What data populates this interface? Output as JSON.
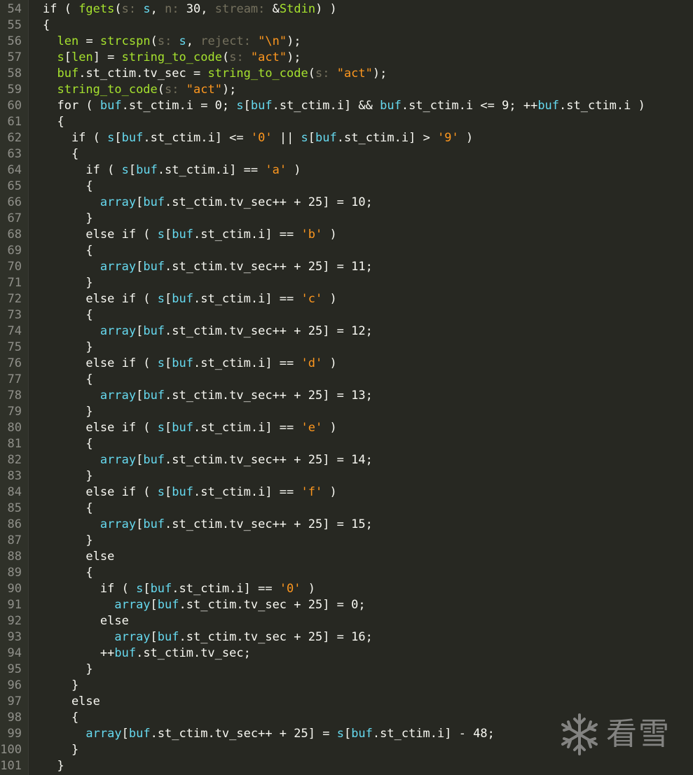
{
  "editor": {
    "first_line_number": 54,
    "lines": [
      [
        [
          "kw",
          "if ( "
        ],
        [
          "fn",
          "fgets"
        ],
        [
          "kw",
          "("
        ],
        [
          "hint",
          "s: "
        ],
        [
          "id",
          "s"
        ],
        [
          "kw",
          ", "
        ],
        [
          "hint",
          "n: "
        ],
        [
          "kw",
          "30, "
        ],
        [
          "hint",
          "stream: "
        ],
        [
          "kw",
          "&"
        ],
        [
          "fn",
          "Stdin"
        ],
        [
          "kw",
          ") )"
        ]
      ],
      [
        [
          "kw",
          "{"
        ]
      ],
      [
        [
          "kw",
          "  "
        ],
        [
          "fn",
          "len"
        ],
        [
          "kw",
          " = "
        ],
        [
          "fn",
          "strcspn"
        ],
        [
          "kw",
          "("
        ],
        [
          "hint",
          "s: "
        ],
        [
          "id",
          "s"
        ],
        [
          "kw",
          ", "
        ],
        [
          "hint",
          "reject: "
        ],
        [
          "str",
          "\"\\n\""
        ],
        [
          "kw",
          ");"
        ]
      ],
      [
        [
          "kw",
          "  "
        ],
        [
          "fn",
          "s"
        ],
        [
          "kw",
          "["
        ],
        [
          "fn",
          "len"
        ],
        [
          "kw",
          "] = "
        ],
        [
          "fn",
          "string_to_code"
        ],
        [
          "kw",
          "("
        ],
        [
          "hint",
          "s: "
        ],
        [
          "str",
          "\"act\""
        ],
        [
          "kw",
          ");"
        ]
      ],
      [
        [
          "kw",
          "  "
        ],
        [
          "fn",
          "buf"
        ],
        [
          "kw",
          ".st_ctim.tv_sec = "
        ],
        [
          "fn",
          "string_to_code"
        ],
        [
          "kw",
          "("
        ],
        [
          "hint",
          "s: "
        ],
        [
          "str",
          "\"act\""
        ],
        [
          "kw",
          ");"
        ]
      ],
      [
        [
          "kw",
          "  "
        ],
        [
          "fn",
          "string_to_code"
        ],
        [
          "kw",
          "("
        ],
        [
          "hint",
          "s: "
        ],
        [
          "str",
          "\"act\""
        ],
        [
          "kw",
          ");"
        ]
      ],
      [
        [
          "kw",
          "  for ( "
        ],
        [
          "id",
          "buf"
        ],
        [
          "kw",
          ".st_ctim.i = 0; "
        ],
        [
          "id",
          "s"
        ],
        [
          "kw",
          "["
        ],
        [
          "id",
          "buf"
        ],
        [
          "kw",
          ".st_ctim.i] && "
        ],
        [
          "id",
          "buf"
        ],
        [
          "kw",
          ".st_ctim.i <= 9; ++"
        ],
        [
          "id",
          "buf"
        ],
        [
          "kw",
          ".st_ctim.i )"
        ]
      ],
      [
        [
          "kw",
          "  {"
        ]
      ],
      [
        [
          "kw",
          "    if ( "
        ],
        [
          "id",
          "s"
        ],
        [
          "kw",
          "["
        ],
        [
          "id",
          "buf"
        ],
        [
          "kw",
          ".st_ctim.i] <= "
        ],
        [
          "str",
          "'0'"
        ],
        [
          "kw",
          " || "
        ],
        [
          "id",
          "s"
        ],
        [
          "kw",
          "["
        ],
        [
          "id",
          "buf"
        ],
        [
          "kw",
          ".st_ctim.i] > "
        ],
        [
          "str",
          "'9'"
        ],
        [
          "kw",
          " )"
        ]
      ],
      [
        [
          "kw",
          "    {"
        ]
      ],
      [
        [
          "kw",
          "      if ( "
        ],
        [
          "id",
          "s"
        ],
        [
          "kw",
          "["
        ],
        [
          "id",
          "buf"
        ],
        [
          "kw",
          ".st_ctim.i] == "
        ],
        [
          "str",
          "'a'"
        ],
        [
          "kw",
          " )"
        ]
      ],
      [
        [
          "kw",
          "      {"
        ]
      ],
      [
        [
          "kw",
          "        "
        ],
        [
          "id",
          "array"
        ],
        [
          "kw",
          "["
        ],
        [
          "id",
          "buf"
        ],
        [
          "kw",
          ".st_ctim.tv_sec++ + 25] = 10;"
        ]
      ],
      [
        [
          "kw",
          "      }"
        ]
      ],
      [
        [
          "kw",
          "      else if ( "
        ],
        [
          "id",
          "s"
        ],
        [
          "kw",
          "["
        ],
        [
          "id",
          "buf"
        ],
        [
          "kw",
          ".st_ctim.i] == "
        ],
        [
          "str",
          "'b'"
        ],
        [
          "kw",
          " )"
        ]
      ],
      [
        [
          "kw",
          "      {"
        ]
      ],
      [
        [
          "kw",
          "        "
        ],
        [
          "id",
          "array"
        ],
        [
          "kw",
          "["
        ],
        [
          "id",
          "buf"
        ],
        [
          "kw",
          ".st_ctim.tv_sec++ + 25] = 11;"
        ]
      ],
      [
        [
          "kw",
          "      }"
        ]
      ],
      [
        [
          "kw",
          "      else if ( "
        ],
        [
          "id",
          "s"
        ],
        [
          "kw",
          "["
        ],
        [
          "id",
          "buf"
        ],
        [
          "kw",
          ".st_ctim.i] == "
        ],
        [
          "str",
          "'c'"
        ],
        [
          "kw",
          " )"
        ]
      ],
      [
        [
          "kw",
          "      {"
        ]
      ],
      [
        [
          "kw",
          "        "
        ],
        [
          "id",
          "array"
        ],
        [
          "kw",
          "["
        ],
        [
          "id",
          "buf"
        ],
        [
          "kw",
          ".st_ctim.tv_sec++ + 25] = 12;"
        ]
      ],
      [
        [
          "kw",
          "      }"
        ]
      ],
      [
        [
          "kw",
          "      else if ( "
        ],
        [
          "id",
          "s"
        ],
        [
          "kw",
          "["
        ],
        [
          "id",
          "buf"
        ],
        [
          "kw",
          ".st_ctim.i] == "
        ],
        [
          "str",
          "'d'"
        ],
        [
          "kw",
          " )"
        ]
      ],
      [
        [
          "kw",
          "      {"
        ]
      ],
      [
        [
          "kw",
          "        "
        ],
        [
          "id",
          "array"
        ],
        [
          "kw",
          "["
        ],
        [
          "id",
          "buf"
        ],
        [
          "kw",
          ".st_ctim.tv_sec++ + 25] = 13;"
        ]
      ],
      [
        [
          "kw",
          "      }"
        ]
      ],
      [
        [
          "kw",
          "      else if ( "
        ],
        [
          "id",
          "s"
        ],
        [
          "kw",
          "["
        ],
        [
          "id",
          "buf"
        ],
        [
          "kw",
          ".st_ctim.i] == "
        ],
        [
          "str",
          "'e'"
        ],
        [
          "kw",
          " )"
        ]
      ],
      [
        [
          "kw",
          "      {"
        ]
      ],
      [
        [
          "kw",
          "        "
        ],
        [
          "id",
          "array"
        ],
        [
          "kw",
          "["
        ],
        [
          "id",
          "buf"
        ],
        [
          "kw",
          ".st_ctim.tv_sec++ + 25] = 14;"
        ]
      ],
      [
        [
          "kw",
          "      }"
        ]
      ],
      [
        [
          "kw",
          "      else if ( "
        ],
        [
          "id",
          "s"
        ],
        [
          "kw",
          "["
        ],
        [
          "id",
          "buf"
        ],
        [
          "kw",
          ".st_ctim.i] == "
        ],
        [
          "str",
          "'f'"
        ],
        [
          "kw",
          " )"
        ]
      ],
      [
        [
          "kw",
          "      {"
        ]
      ],
      [
        [
          "kw",
          "        "
        ],
        [
          "id",
          "array"
        ],
        [
          "kw",
          "["
        ],
        [
          "id",
          "buf"
        ],
        [
          "kw",
          ".st_ctim.tv_sec++ + 25] = 15;"
        ]
      ],
      [
        [
          "kw",
          "      }"
        ]
      ],
      [
        [
          "kw",
          "      else"
        ]
      ],
      [
        [
          "kw",
          "      {"
        ]
      ],
      [
        [
          "kw",
          "        if ( "
        ],
        [
          "id",
          "s"
        ],
        [
          "kw",
          "["
        ],
        [
          "id",
          "buf"
        ],
        [
          "kw",
          ".st_ctim.i] == "
        ],
        [
          "str",
          "'0'"
        ],
        [
          "kw",
          " )"
        ]
      ],
      [
        [
          "kw",
          "          "
        ],
        [
          "id",
          "array"
        ],
        [
          "kw",
          "["
        ],
        [
          "id",
          "buf"
        ],
        [
          "kw",
          ".st_ctim.tv_sec + 25] = 0;"
        ]
      ],
      [
        [
          "kw",
          "        else"
        ]
      ],
      [
        [
          "kw",
          "          "
        ],
        [
          "id",
          "array"
        ],
        [
          "kw",
          "["
        ],
        [
          "id",
          "buf"
        ],
        [
          "kw",
          ".st_ctim.tv_sec + 25] = 16;"
        ]
      ],
      [
        [
          "kw",
          "        ++"
        ],
        [
          "id",
          "buf"
        ],
        [
          "kw",
          ".st_ctim.tv_sec;"
        ]
      ],
      [
        [
          "kw",
          "      }"
        ]
      ],
      [
        [
          "kw",
          "    }"
        ]
      ],
      [
        [
          "kw",
          "    else"
        ]
      ],
      [
        [
          "kw",
          "    {"
        ]
      ],
      [
        [
          "kw",
          "      "
        ],
        [
          "id",
          "array"
        ],
        [
          "kw",
          "["
        ],
        [
          "id",
          "buf"
        ],
        [
          "kw",
          ".st_ctim.tv_sec++ + 25] = "
        ],
        [
          "id",
          "s"
        ],
        [
          "kw",
          "["
        ],
        [
          "id",
          "buf"
        ],
        [
          "kw",
          ".st_ctim.i] - 48;"
        ]
      ],
      [
        [
          "kw",
          "    }"
        ]
      ],
      [
        [
          "kw",
          "  }"
        ]
      ]
    ]
  },
  "watermark": {
    "text": "看雪",
    "icon": "snowflake-icon"
  },
  "colors": {
    "background": "#272822",
    "gutter": "#2f3129",
    "default_text": "#f8f8f2",
    "identifier": "#66d9ef",
    "function": "#a6e22e",
    "string": "#fd971f",
    "param_hint": "#75715e",
    "line_number": "#90908a"
  }
}
